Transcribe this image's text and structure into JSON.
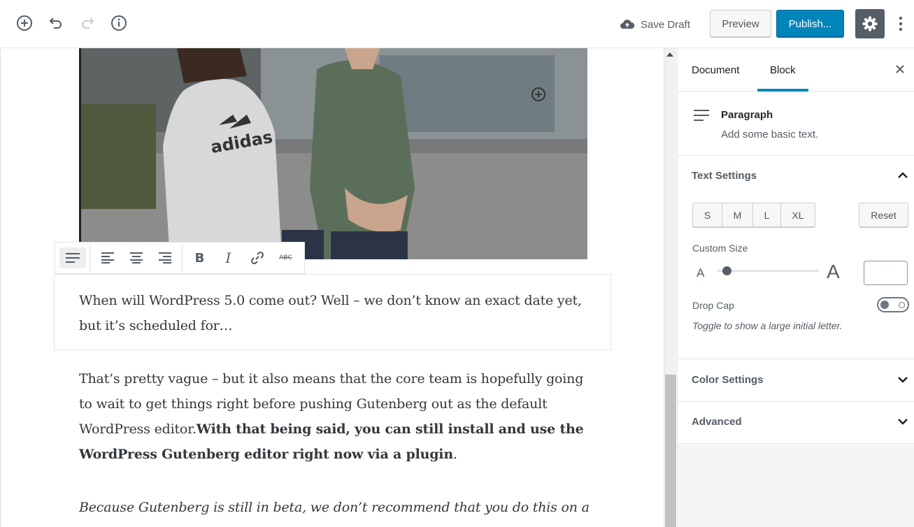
{
  "toolbar": {
    "icons": [
      "add-block-icon",
      "undo-icon",
      "redo-icon",
      "info-icon"
    ],
    "save_draft": "Save Draft",
    "preview": "Preview",
    "publish": "Publish...",
    "settings_icon": "gear-icon",
    "more_icon": "vertical-ellipsis-icon"
  },
  "block_toolbar": {
    "buttons": [
      "paragraph-icon",
      "align-left-icon",
      "align-center-icon",
      "align-right-icon",
      "bold-icon",
      "italic-icon",
      "link-icon",
      "strikethrough-icon"
    ],
    "bold_label": "B",
    "italic_label": "I",
    "strike_label": "ABC"
  },
  "content": {
    "image": {
      "shirt_text": "adidas"
    },
    "para1": "When will WordPress 5.0 come out? Well – we don’t know an exact date yet, but it’s scheduled for…",
    "para2_normal": "That’s pretty vague – but it also means that the core team is hopefully going to wait to get things right before pushing Gutenberg out as the default WordPress editor.",
    "para2_bold": "With that being said, you can still install and use the WordPress Gutenberg editor right now via a plugin",
    "para2_end": ".",
    "para3": "Because Gutenberg is still in beta, we don’t recommend that you do this on a live site of yours"
  },
  "sidebar": {
    "tabs": {
      "document": "Document",
      "block": "Block"
    },
    "active_tab": "Block",
    "block_card": {
      "title": "Paragraph",
      "description": "Add some basic text."
    },
    "text_settings": {
      "title": "Text Settings",
      "sizes": [
        "S",
        "M",
        "L",
        "XL"
      ],
      "reset": "Reset",
      "custom_size_label": "Custom Size",
      "a_small": "A",
      "a_large": "A",
      "slider_value_fraction": 0.1,
      "custom_size_value": "",
      "drop_cap_label": "Drop Cap",
      "drop_cap_on": false,
      "drop_cap_help": "Toggle to show a large initial letter."
    },
    "color_settings": {
      "title": "Color Settings"
    },
    "advanced": {
      "title": "Advanced"
    }
  },
  "colors": {
    "primary": "#0085ba",
    "settings_bg": "#555d66"
  }
}
